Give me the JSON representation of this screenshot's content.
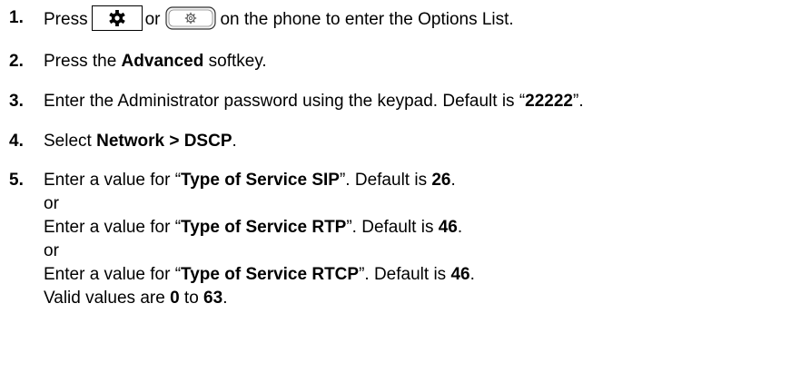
{
  "steps": [
    {
      "num": "1.",
      "pre": "Press",
      "mid": "or",
      "post": "on the phone to enter the Options List.",
      "icons": [
        "gear-icon",
        "settings-key-icon"
      ]
    },
    {
      "num": "2.",
      "t1": "Press the ",
      "b1": "Advanced",
      "t2": " softkey."
    },
    {
      "num": "3.",
      "t1": "Enter the Administrator password using the keypad. Default is “",
      "b1": "22222",
      "t2": "”."
    },
    {
      "num": "4.",
      "t1": "Select ",
      "b1": "Network > DSCP",
      "t2": "."
    },
    {
      "num": "5.",
      "lines": [
        {
          "t1": "Enter a value for “",
          "b1": "Type of Service SIP",
          "t2": "”. Default is ",
          "b2": "26",
          "t3": "."
        },
        {
          "t1": "or"
        },
        {
          "t1": "Enter a value for “",
          "b1": "Type of Service RTP",
          "t2": "”. Default is ",
          "b2": "46",
          "t3": "."
        },
        {
          "t1": "or"
        },
        {
          "t1": "Enter a value for “",
          "b1": "Type of Service RTCP",
          "t2": "”. Default is ",
          "b2": "46",
          "t3": "."
        },
        {
          "t1": "Valid values are ",
          "b1": "0",
          "t2": " to ",
          "b2": "63",
          "t3": "."
        }
      ]
    }
  ]
}
